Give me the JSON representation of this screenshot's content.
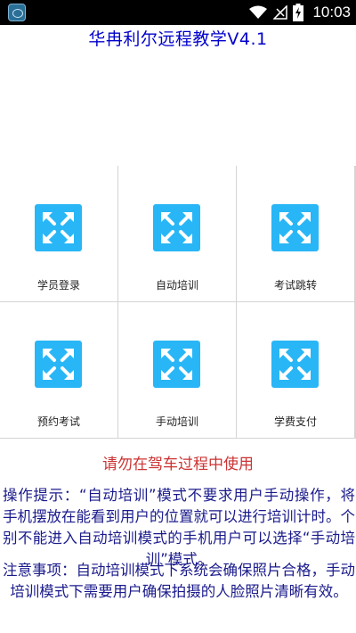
{
  "status_bar": {
    "time": "10:03",
    "icons": [
      "wifi-icon",
      "signal-icon",
      "battery-charging-icon"
    ],
    "app_icon": "app-notification-icon"
  },
  "app": {
    "title": "华冉利尔远程教学V4.1"
  },
  "menu": {
    "items": [
      {
        "label": "学员登录",
        "icon": "expand-arrows-icon"
      },
      {
        "label": "自动培训",
        "icon": "expand-arrows-icon"
      },
      {
        "label": "考试跳转",
        "icon": "expand-arrows-icon"
      },
      {
        "label": "预约考试",
        "icon": "expand-arrows-icon"
      },
      {
        "label": "手动培训",
        "icon": "expand-arrows-icon"
      },
      {
        "label": "学费支付",
        "icon": "expand-arrows-icon"
      }
    ]
  },
  "warning": "请勿在驾车过程中使用",
  "tip": "操作提示：“自动培训”模式不要求用户手动操作，将手机摆放在能看到用户的位置就可以进行培训计时。个别不能进入自动培训模式的手机用户可以选择“手动培训”模式。",
  "notice": "注意事项：自动培训模式下系统会确保照片合格，手动培训模式下需要用户确保拍摄的人脸照片清晰有效。",
  "colors": {
    "title": "#0000cc",
    "warning": "#cc3333",
    "body_text": "#1a1a8c",
    "tile_icon": "#29b6f6"
  }
}
